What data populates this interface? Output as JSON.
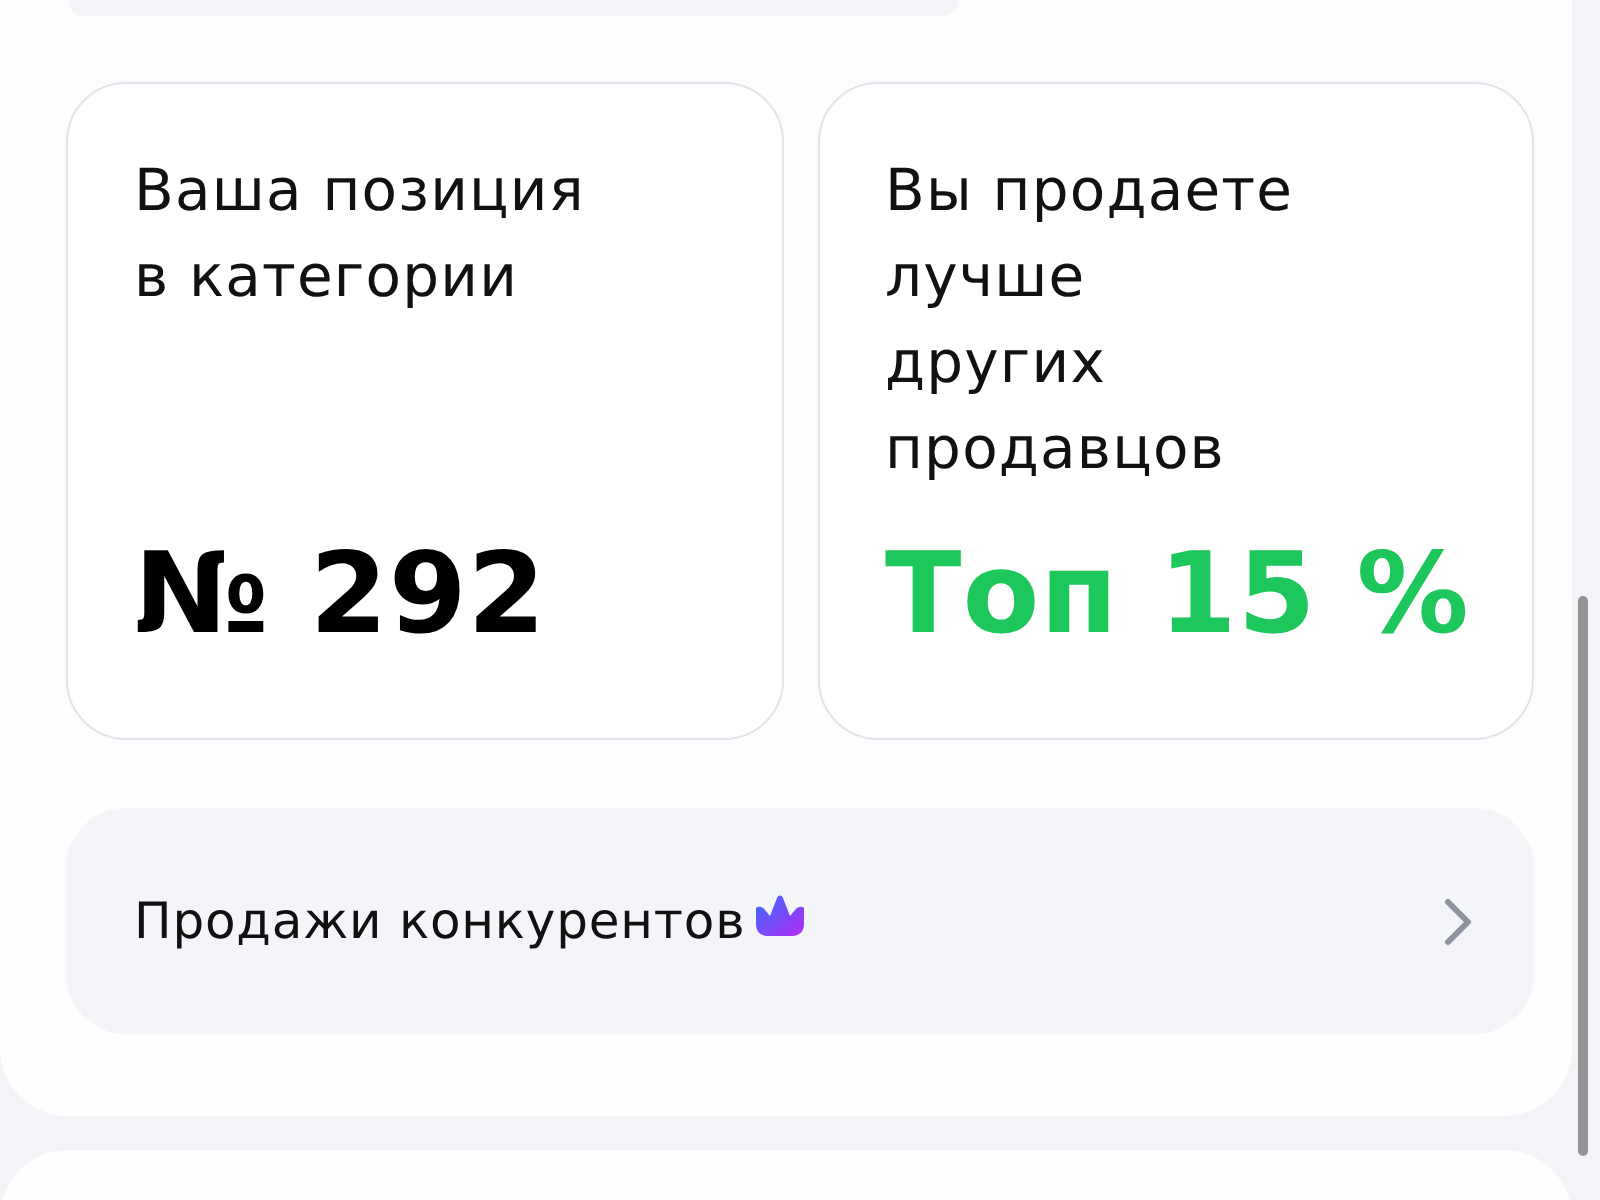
{
  "stats": [
    {
      "label_lines": [
        "Ваша позиция",
        "в категории"
      ],
      "value": "№ 292",
      "color": "#000000"
    },
    {
      "label_lines": [
        "Вы продаете",
        "лучше",
        "других",
        "продавцов"
      ],
      "value": "Топ 15 %",
      "color": "#1ec75b"
    }
  ],
  "competitors_link": {
    "label": "Продажи конкурентов",
    "premium": true
  }
}
